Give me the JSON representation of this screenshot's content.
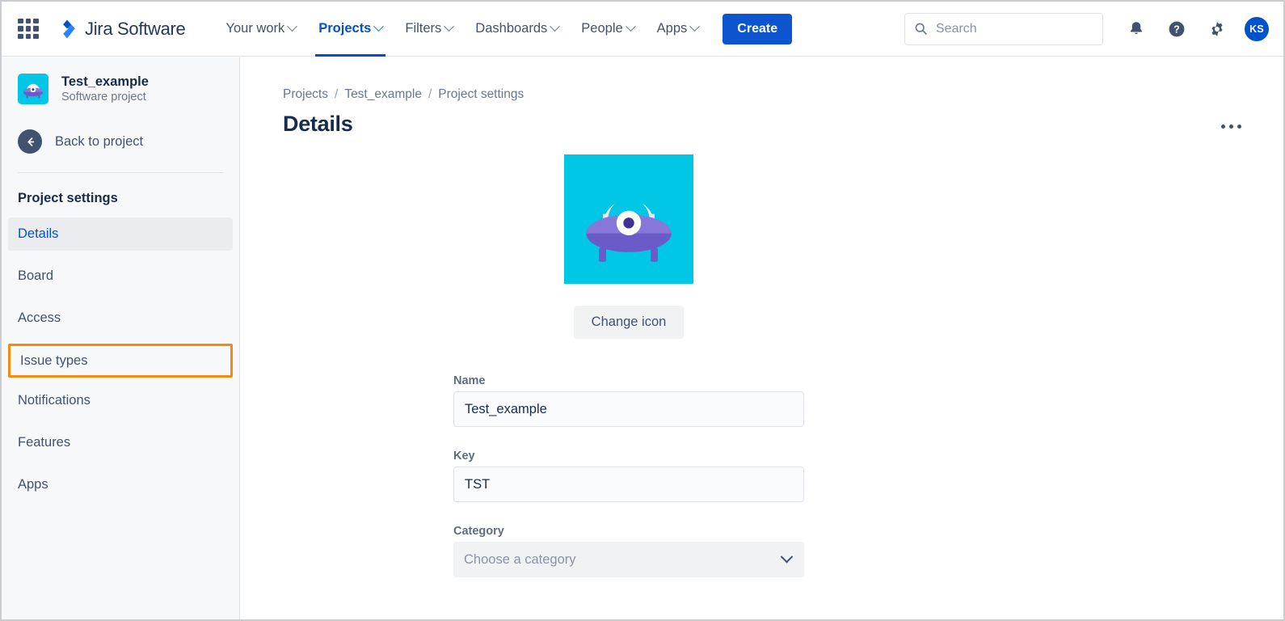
{
  "topnav": {
    "app_switcher_label": "App switcher",
    "brand": "Jira Software",
    "nav": [
      {
        "label": "Your work",
        "active": false
      },
      {
        "label": "Projects",
        "active": true
      },
      {
        "label": "Filters",
        "active": false
      },
      {
        "label": "Dashboards",
        "active": false
      },
      {
        "label": "People",
        "active": false
      },
      {
        "label": "Apps",
        "active": false
      }
    ],
    "create_label": "Create",
    "search": {
      "placeholder": "Search",
      "value": ""
    },
    "icons": [
      "notification-bell-icon",
      "help-icon",
      "settings-gear-icon"
    ],
    "avatar_initials": "KS"
  },
  "sidebar": {
    "project_name": "Test_example",
    "project_type": "Software project",
    "back_label": "Back to project",
    "section_title": "Project settings",
    "items": [
      {
        "label": "Details",
        "active": true,
        "highlighted": false
      },
      {
        "label": "Board",
        "active": false,
        "highlighted": false
      },
      {
        "label": "Access",
        "active": false,
        "highlighted": false
      },
      {
        "label": "Issue types",
        "active": false,
        "highlighted": true
      },
      {
        "label": "Notifications",
        "active": false,
        "highlighted": false
      },
      {
        "label": "Features",
        "active": false,
        "highlighted": false
      },
      {
        "label": "Apps",
        "active": false,
        "highlighted": false
      }
    ]
  },
  "main": {
    "breadcrumb": [
      "Projects",
      "Test_example",
      "Project settings"
    ],
    "breadcrumb_separator": "/",
    "page_title": "Details",
    "more_actions_label": "More actions",
    "change_icon_label": "Change icon",
    "fields": {
      "name_label": "Name",
      "name_value": "Test_example",
      "key_label": "Key",
      "key_value": "TST",
      "category_label": "Category",
      "category_placeholder": "Choose a category"
    }
  },
  "colors": {
    "brand_blue": "#0052CC",
    "create_blue": "#0C55CF",
    "highlight_orange": "#F28B10",
    "active_bg": "#EBECF0",
    "sidebar_bg": "#F7F8F9",
    "text_dark": "#172B4D",
    "text_muted": "#6B778C",
    "icon_cyan": "#00B8D9",
    "icon_purple": "#8777D9"
  }
}
